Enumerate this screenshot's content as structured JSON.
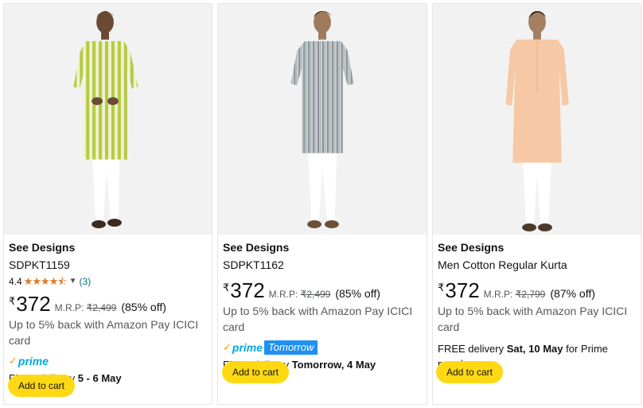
{
  "colors": {
    "star": "#de7921",
    "link": "#007185",
    "prime_blue": "#00a8e1",
    "prime_check": "#f7a000",
    "tomorrow_badge": "#1f8ff4",
    "button": "#ffd814"
  },
  "products": [
    {
      "brand": "See Designs",
      "title": "SDPKT1159",
      "rating": "4.4",
      "stars": "★★★★⯪",
      "review_count": "(3)",
      "currency": "₹",
      "price": "372",
      "mrp_label": "M.R.P:",
      "mrp_value": "₹2,499",
      "discount": "(85% off)",
      "cashback": "Up to 5% back with Amazon Pay ICICI card",
      "prime_label": "prime",
      "delivery_prefix": "FREE delivery ",
      "delivery_date": "5 - 6 May",
      "delivery_suffix": "",
      "add_to_cart": "Add to cart",
      "image_alt": "Green and white striped kurta with white pyjama"
    },
    {
      "brand": "See Designs",
      "title": "SDPKT1162",
      "currency": "₹",
      "price": "372",
      "mrp_label": "M.R.P:",
      "mrp_value": "₹2,499",
      "discount": "(85% off)",
      "cashback": "Up to 5% back with Amazon Pay ICICI card",
      "prime_label": "prime",
      "prime_badge": "Tomorrow",
      "delivery_prefix": "FREE delivery ",
      "delivery_date": "Tomorrow, 4 May",
      "delivery_suffix": "",
      "add_to_cart": "Add to cart",
      "image_alt": "Grey printed kurta with white pyjama"
    },
    {
      "brand": "See Designs",
      "title": "Men Cotton Regular Kurta",
      "currency": "₹",
      "price": "372",
      "mrp_label": "M.R.P:",
      "mrp_value": "₹2,799",
      "discount": "(87% off)",
      "cashback": "Up to 5% back with Amazon Pay ICICI card",
      "delivery_prefix": "FREE delivery ",
      "delivery_date": "Sat, 10 May",
      "delivery_suffix": " for Prime members",
      "add_to_cart": "Add to cart",
      "image_alt": "Peach cotton kurta with white pyjama"
    }
  ]
}
